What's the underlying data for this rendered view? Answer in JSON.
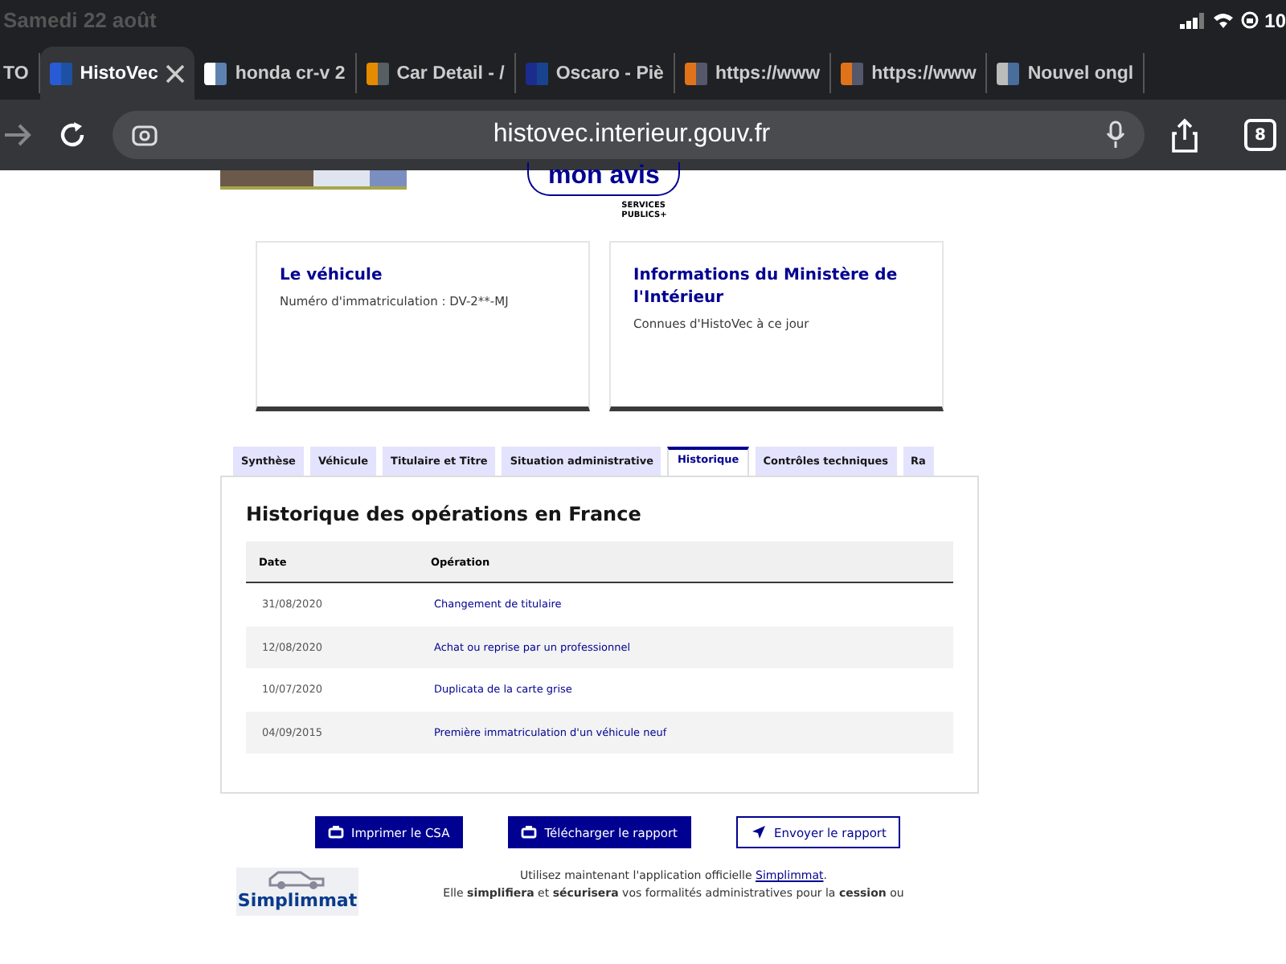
{
  "status_bar": {
    "date": "Samedi 22 août",
    "battery": "10"
  },
  "browser_tabs": [
    {
      "title": "TO",
      "selected": false
    },
    {
      "title": "HistoVec",
      "selected": true
    },
    {
      "title": "honda cr-v 2",
      "selected": false
    },
    {
      "title": "Car Detail - /",
      "selected": false
    },
    {
      "title": "Oscaro - Piè",
      "selected": false
    },
    {
      "title": "https://www",
      "selected": false
    },
    {
      "title": "https://www",
      "selected": false
    },
    {
      "title": "Nouvel ongl",
      "selected": false
    }
  ],
  "address_bar": {
    "url": "histovec.interieur.gouv.fr",
    "tab_count": "8"
  },
  "feedback": {
    "label": "mon avis",
    "brand": "SERVICES PUBLICS+"
  },
  "cards": [
    {
      "title": "Le véhicule",
      "text": "Numéro d'immatriculation : DV-2**-MJ"
    },
    {
      "title": "Informations du Ministère de l'Intérieur",
      "text": "Connues d'HistoVec à ce jour"
    }
  ],
  "tabs": [
    {
      "label": "Synthèse",
      "selected": false
    },
    {
      "label": "Véhicule",
      "selected": false
    },
    {
      "label": "Titulaire et Titre",
      "selected": false
    },
    {
      "label": "Situation administrative",
      "selected": false
    },
    {
      "label": "Historique",
      "selected": true
    },
    {
      "label": "Contrôles techniques",
      "selected": false
    },
    {
      "label": "Ra",
      "selected": false
    }
  ],
  "panel": {
    "title": "Historique des opérations en France",
    "table": {
      "columns": [
        "Date",
        "Opération"
      ],
      "rows": [
        [
          "31/08/2020",
          "Changement de titulaire"
        ],
        [
          "12/08/2020",
          "Achat ou reprise par un professionnel"
        ],
        [
          "10/07/2020",
          "Duplicata de la carte grise"
        ],
        [
          "04/09/2015",
          "Première immatriculation d'un véhicule neuf"
        ]
      ]
    }
  },
  "actions": [
    {
      "label": "Imprimer le CSA",
      "kind": "primary"
    },
    {
      "label": "Télécharger le rapport",
      "kind": "primary"
    },
    {
      "label": "Envoyer le rapport",
      "kind": "secondary"
    }
  ],
  "footer": {
    "logo": "Simplimmat",
    "line1_before": "Utilisez maintenant l'application officielle ",
    "link": "Simplimmat",
    "line1_after": ".",
    "line2": "Elle **simplifiera** et **sécurisera** vos formalités administratives pour la **cession** ou"
  }
}
